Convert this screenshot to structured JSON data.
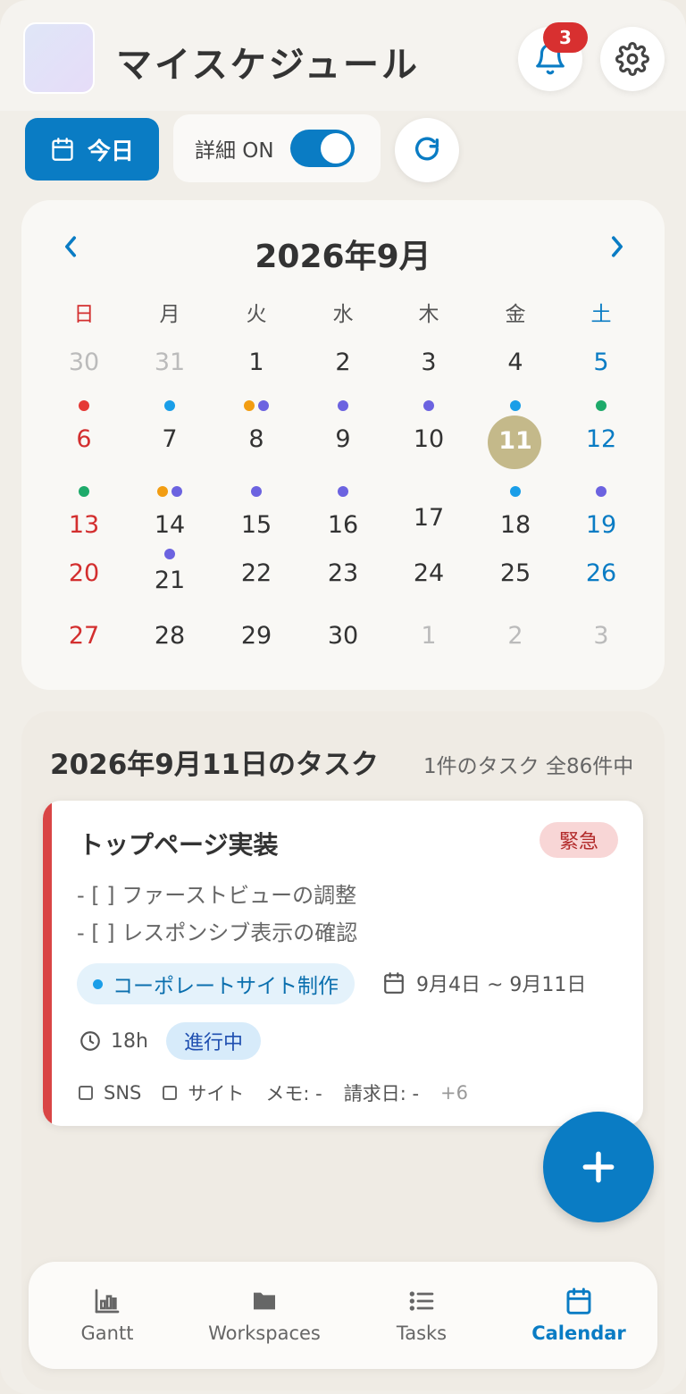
{
  "header": {
    "title": "マイスケジュール",
    "notification_count": "3"
  },
  "toolbar": {
    "today_label": "今日",
    "detail_label": "詳細 ON",
    "detail_toggle_on": true
  },
  "calendar": {
    "title": "2026年9月",
    "weekdays": [
      "日",
      "月",
      "火",
      "水",
      "木",
      "金",
      "土"
    ],
    "weeks": [
      [
        "30",
        "31",
        "1",
        "2",
        "3",
        "4",
        "5"
      ],
      [
        "6",
        "7",
        "8",
        "9",
        "10",
        "11",
        "12"
      ],
      [
        "13",
        "14",
        "15",
        "16",
        "17",
        "18",
        "19"
      ],
      [
        "20",
        "21",
        "22",
        "23",
        "24",
        "25",
        "26"
      ],
      [
        "27",
        "28",
        "29",
        "30",
        "1",
        "2",
        "3"
      ]
    ],
    "selected_day": "11",
    "colors": {
      "sunday": "#d32f2f",
      "saturday": "#0a7cc4",
      "outside": "#bbbbbb",
      "dot_red": "#e53935",
      "dot_blue": "#1a9ee8",
      "dot_orange": "#f29d12",
      "dot_purple": "#6c63e0",
      "dot_green": "#1eaa6a"
    }
  },
  "tasks_section": {
    "header": "2026年9月11日のタスク",
    "count": "1件のタスク 全86件中"
  },
  "task": {
    "title": "トップページ実装",
    "priority": "緊急",
    "desc_lines": [
      "- [ ] ファーストビューの調整",
      "- [ ] レスポンシブ表示の確認"
    ],
    "project": "コーポレートサイト制作",
    "date_range": "9月4日 ~ 9月11日",
    "hours": "18h",
    "status": "進行中",
    "meta": {
      "sns": "SNS",
      "site": "サイト",
      "memo": "メモ: -",
      "billing": "請求日: -",
      "more": "+6"
    }
  },
  "nav": {
    "items": [
      {
        "label": "Gantt",
        "icon": "chart-icon"
      },
      {
        "label": "Workspaces",
        "icon": "folder-icon"
      },
      {
        "label": "Tasks",
        "icon": "list-icon"
      },
      {
        "label": "Calendar",
        "icon": "calendar-icon"
      }
    ],
    "active": "Calendar"
  }
}
